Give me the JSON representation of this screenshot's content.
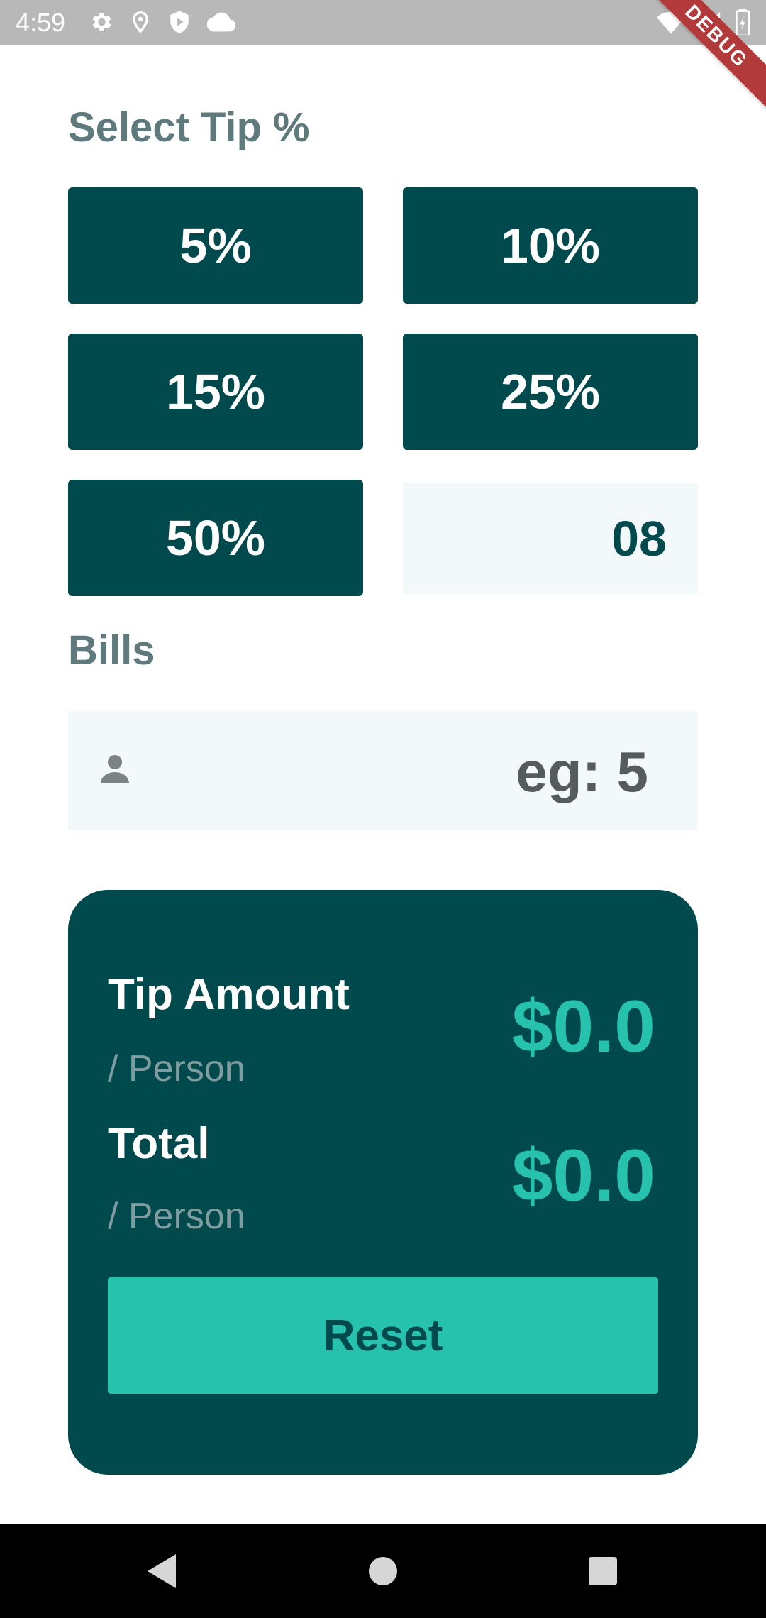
{
  "status_bar": {
    "time": "4:59",
    "left_icons": [
      "gear-icon",
      "location-icon",
      "shield-play-icon",
      "cloud-icon"
    ],
    "right_icons": [
      "wifi-icon",
      "signal-icon",
      "battery-icon"
    ]
  },
  "debug_banner": "DEBUG",
  "tip_section": {
    "title": "Select Tip %",
    "options": [
      "5%",
      "10%",
      "15%",
      "25%",
      "50%"
    ],
    "custom_value": "08"
  },
  "bills_section": {
    "title": "Bills",
    "placeholder": "eg: 5",
    "icon": "person-icon"
  },
  "result": {
    "tip_amount_label": "Tip Amount",
    "tip_amount_sub": "/ Person",
    "tip_amount_value": "$0.0",
    "total_label": "Total",
    "total_sub": "/ Person",
    "total_value": "$0.0",
    "reset_label": "Reset"
  },
  "nav_bar": {
    "buttons": [
      "back-icon",
      "home-icon",
      "recents-icon"
    ]
  },
  "colors": {
    "primary": "#00494d",
    "accent": "#26c2ad",
    "label": "#5e7a7d",
    "input_bg": "#f3f8fb",
    "debug": "#b23a3a"
  }
}
